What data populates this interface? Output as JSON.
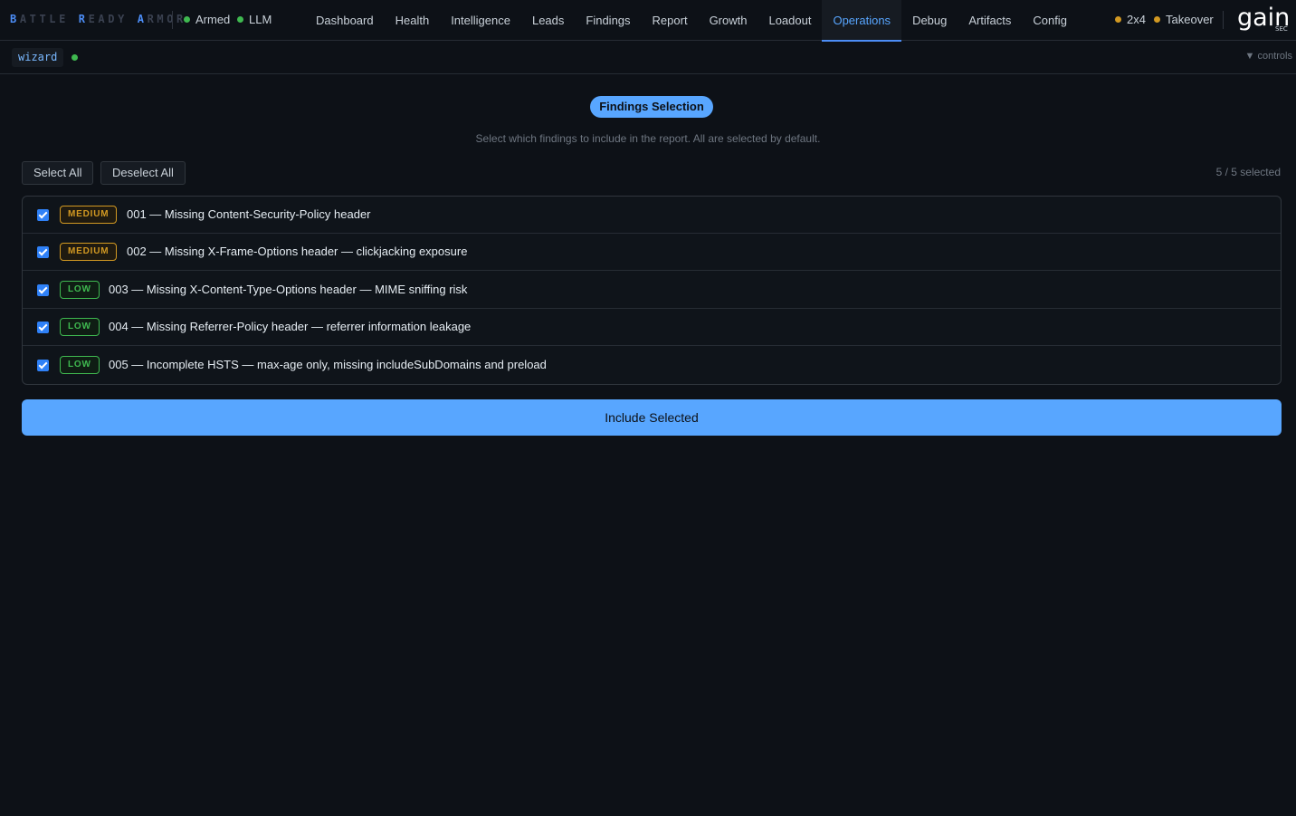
{
  "brand": {
    "parts": [
      {
        "cap": "B",
        "rest": "ATTLE"
      },
      {
        "cap": "R",
        "rest": "EADY"
      },
      {
        "cap": "A",
        "rest": "RMOR"
      }
    ]
  },
  "status_left": [
    {
      "label": "Armed",
      "color": "#3fb950"
    },
    {
      "label": "LLM",
      "color": "#3fb950"
    }
  ],
  "nav": {
    "tabs": [
      "Dashboard",
      "Health",
      "Intelligence",
      "Leads",
      "Findings",
      "Report",
      "Growth",
      "Loadout",
      "Operations",
      "Debug",
      "Artifacts",
      "Config"
    ],
    "active": "Operations"
  },
  "status_right": [
    {
      "label": "2x4",
      "color": "#d29922"
    },
    {
      "label": "Takeover",
      "color": "#d29922"
    }
  ],
  "logo": {
    "text": "gain",
    "sub": "SEC"
  },
  "subbar": {
    "mode": "wizard",
    "controls_label": "▼ controls"
  },
  "wizard": {
    "step_title": "Findings Selection",
    "description": "Select which findings to include in the report. All are selected by default.",
    "select_all_label": "Select All",
    "deselect_all_label": "Deselect All",
    "selected_count": "5 / 5 selected",
    "include_label": "Include Selected"
  },
  "findings": [
    {
      "severity": "MEDIUM",
      "title": "001 — Missing Content-Security-Policy header",
      "checked": true
    },
    {
      "severity": "MEDIUM",
      "title": "002 — Missing X-Frame-Options header — clickjacking exposure",
      "checked": true
    },
    {
      "severity": "LOW",
      "title": "003 — Missing X-Content-Type-Options header — MIME sniffing risk",
      "checked": true
    },
    {
      "severity": "LOW",
      "title": "004 — Missing Referrer-Policy header — referrer information leakage",
      "checked": true
    },
    {
      "severity": "LOW",
      "title": "005 — Incomplete HSTS — max-age only, missing includeSubDomains and preload",
      "checked": true
    }
  ]
}
